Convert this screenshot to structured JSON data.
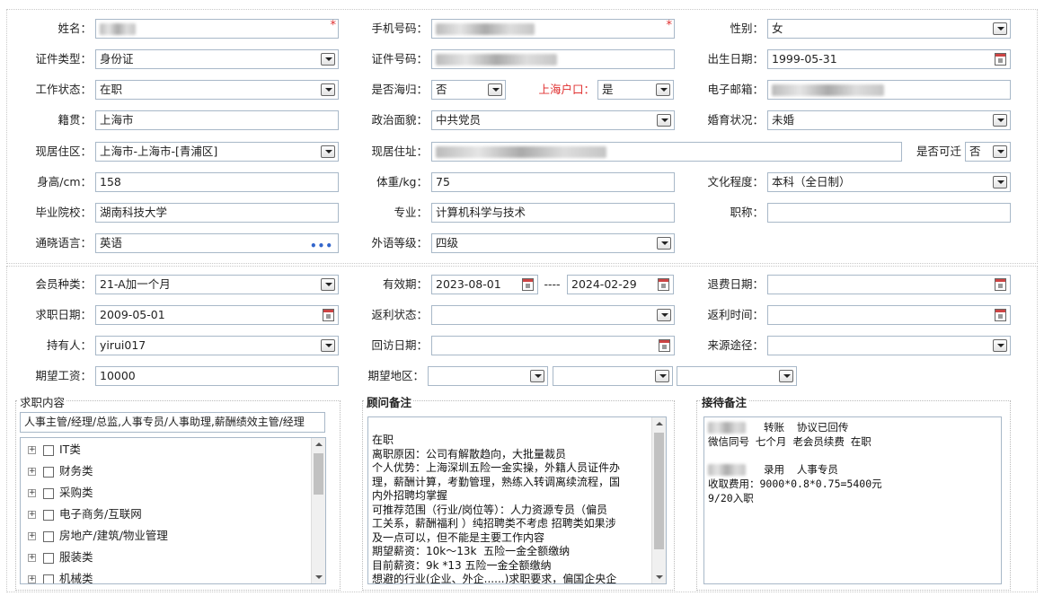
{
  "labels": {
    "name": "姓名：",
    "phone": "手机号码：",
    "gender": "性别：",
    "id_type": "证件类型：",
    "id_no": "证件号码：",
    "birth": "出生日期：",
    "work_status": "工作状态：",
    "overseas": "是否海归：",
    "sh_hukou": "上海户口：",
    "email": "电子邮箱：",
    "native": "籍贯：",
    "political": "政治面貌：",
    "marital": "婚育状况：",
    "residence_area": "现居住区：",
    "residence_addr": "现居住址：",
    "relocate": "是否可迁",
    "height": "身高/cm：",
    "weight": "体重/kg：",
    "education": "文化程度：",
    "school": "毕业院校：",
    "major": "专业：",
    "title": "职称：",
    "languages": "通晓语言：",
    "fl_level": "外语等级：",
    "member_type": "会员种类：",
    "valid": "有效期：",
    "refund_date": "退费日期：",
    "job_date": "求职日期：",
    "rebate_status": "返利状态：",
    "rebate_time": "返利时间：",
    "holder": "持有人：",
    "visit_date": "回访日期：",
    "source": "来源途径：",
    "expected_salary": "期望工资：",
    "expected_area": "期望地区："
  },
  "values": {
    "gender": "女",
    "id_type": "身份证",
    "birth": "1999-05-31",
    "work_status": "在职",
    "overseas": "否",
    "sh_hukou": "是",
    "native": "上海市",
    "political": "中共党员",
    "marital": "未婚",
    "residence_area": "上海市-上海市-[青浦区]",
    "relocate": "否",
    "height": "158",
    "weight": "75",
    "education": "本科（全日制）",
    "school": "湖南科技大学",
    "major": "计算机科学与技术",
    "title": "",
    "languages": "英语",
    "fl_level": "四级",
    "member_type": "21-A加一个月",
    "valid_from": "2023-08-01",
    "valid_sep": "----",
    "valid_to": "2024-02-29",
    "job_date": "2009-05-01",
    "holder": "yirui017",
    "expected_salary": "10000"
  },
  "sections": {
    "job_content": "求职内容",
    "consultant_notes": "顾问备注",
    "reception_notes": "接待备注"
  },
  "job_content_text": "人事主管/经理/总监,人事专员/人事助理,薪酬绩效主管/经理",
  "tree_items": [
    "IT类",
    "财务类",
    "采购类",
    "电子商务/互联网",
    "房地产/建筑/物业管理",
    "服装类",
    "机械类"
  ],
  "consultant_lines": [
    "",
    "在职",
    "离职原因：公司有解散趋向，大批量裁员",
    "个人优势：上海深圳五险一金实操，外籍人员证件办",
    "理，薪酬计算，考勤管理，熟练入转调离续流程，国",
    "内外招聘均掌握",
    "可推荐范围（行业/岗位等）：人力资源专员（偏员",
    "工关系，薪酬福利 ）纯招聘类不考虑 招聘类如果涉",
    "及一点可以，但不能是主要工作内容",
    "期望薪资：10k～13k  五险一金全额缴纳",
    "目前薪资：9k *13 五险一金全额缴纳",
    "想避的行业(企业、外企......)求职要求，偏国企央企"
  ],
  "reception_lines": [
    "转账  协议已回传",
    "微信同号 七个月 老会员续费 在职",
    "",
    "录用  人事专员",
    "收取费用：9000*0.8*0.75=5400元",
    "9/20入职"
  ],
  "colors": {
    "required": "#e03030",
    "field_border": "#a8b8c8",
    "link_dots": "#3366cc"
  }
}
